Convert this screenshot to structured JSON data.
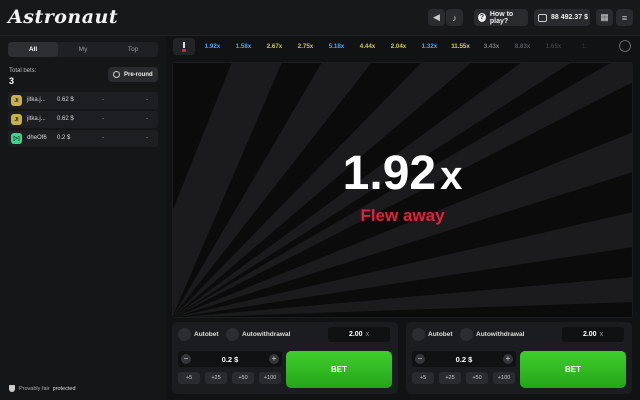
{
  "header": {
    "logo": "Astronaut",
    "sound_icon": "speaker-icon",
    "music_icon": "music-note-icon",
    "how_to_play": "How to play?",
    "balance": "88 492.37 $",
    "menu_icon": "grid-menu-icon"
  },
  "left_panel": {
    "tabs": [
      "All",
      "My",
      "Top"
    ],
    "active_tab": "All",
    "total_bets_label": "Total bets:",
    "total_bets_value": "3",
    "preround_label": "Pre-round",
    "bets": [
      {
        "avatar": "JI",
        "name": "jitka.j...",
        "amount": "0.62 $",
        "multiplier": "-",
        "win": "-",
        "avatar_color": "#c9b04a"
      },
      {
        "avatar": "JI",
        "name": "jitka.j...",
        "amount": "0.62 $",
        "multiplier": "-",
        "win": "-",
        "avatar_color": "#c9b04a"
      },
      {
        "avatar": "[>]",
        "name": "dheOf6",
        "amount": "0.2 $",
        "multiplier": "-",
        "win": "-",
        "avatar_color": "#3bd68a"
      }
    ],
    "provably_fair": "Provably fair",
    "protected": "protected"
  },
  "history": [
    {
      "value": "1.92x",
      "color": "#4aa3ff"
    },
    {
      "value": "1.58x",
      "color": "#4aa3ff"
    },
    {
      "value": "2.67x",
      "color": "#c9c94a"
    },
    {
      "value": "2.75x",
      "color": "#c9c94a"
    },
    {
      "value": "5.18x",
      "color": "#4aa3ff"
    },
    {
      "value": "4.44x",
      "color": "#c9c94a"
    },
    {
      "value": "2.04x",
      "color": "#c9c94a"
    },
    {
      "value": "1.32x",
      "color": "#4aa3ff"
    },
    {
      "value": "11.55x",
      "color": "#d6d64a"
    },
    {
      "value": "3.43x",
      "color": "#7a7b80"
    },
    {
      "value": "8.83x",
      "color": "#55565a"
    },
    {
      "value": "1.65x",
      "color": "#3c3d40"
    },
    {
      "value": "1.",
      "color": "#2e2f32"
    }
  ],
  "game": {
    "multiplier": "1.92",
    "multiplier_suffix": "x",
    "status": "Flew away"
  },
  "panels": [
    {
      "autobet": "Autobet",
      "autowithdrawal": "Autowithdrawal",
      "auto_value": "2.00",
      "auto_suffix": "x",
      "stake": "0.2 $",
      "minus": "−",
      "plus": "+",
      "quick": [
        "+5",
        "+25",
        "+50",
        "+100"
      ],
      "bet": "BET"
    },
    {
      "autobet": "Autobet",
      "autowithdrawal": "Autowithdrawal",
      "auto_value": "2.00",
      "auto_suffix": "x",
      "stake": "0.2 $",
      "minus": "−",
      "plus": "+",
      "quick": [
        "+5",
        "+25",
        "+50",
        "+100"
      ],
      "bet": "BET"
    }
  ]
}
